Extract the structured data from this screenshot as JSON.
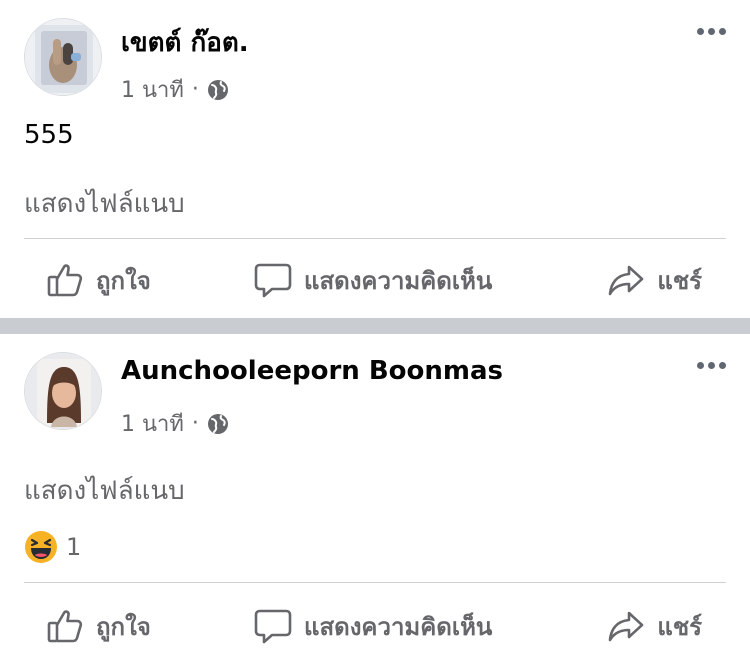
{
  "posts": [
    {
      "author": "เขตต์ ก๊อต.",
      "time": "1 นาที",
      "separator_dot": "·",
      "body": "555",
      "attachment_link": "แสดงไฟล์แนบ",
      "avatar_icon": "profile-photo-hand",
      "actions": {
        "like": "ถูกใจ",
        "comment": "แสดงความคิดเห็น",
        "share": "แชร์"
      }
    },
    {
      "author": "Aunchooleeporn Boonmas",
      "time": "1 นาที",
      "separator_dot": "·",
      "attachment_link": "แสดงไฟล์แนบ",
      "avatar_icon": "profile-photo-person",
      "reaction": {
        "icon": "haha-emoji-icon",
        "count": "1"
      },
      "actions": {
        "like": "ถูกใจ",
        "comment": "แสดงความคิดเห็น",
        "share": "แชร์"
      }
    }
  ],
  "icons": {
    "more": "more-options-icon",
    "privacy": "globe-icon",
    "like": "thumbs-up-icon",
    "comment": "comment-bubble-icon",
    "share": "share-arrow-icon"
  },
  "colors": {
    "text_primary": "#050505",
    "text_secondary": "#65676b",
    "separator": "#c9ccd1",
    "divider": "#ced0d4",
    "haha_yellow": "#f7b125"
  }
}
